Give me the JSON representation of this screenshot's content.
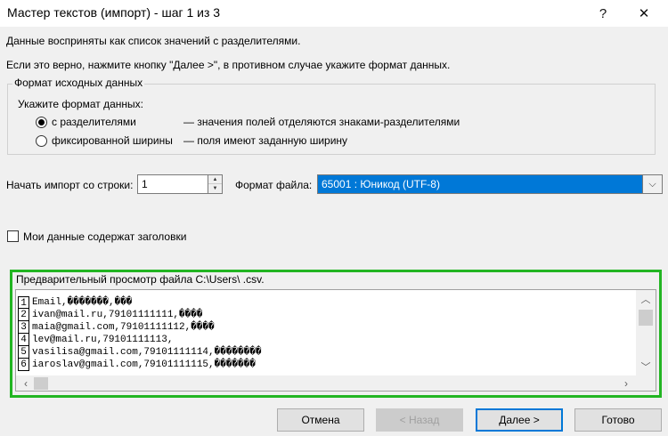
{
  "window": {
    "title": "Мастер текстов (импорт) - шаг 1 из 3",
    "help_glyph": "?",
    "close_glyph": "✕"
  },
  "intro": {
    "line1": "Данные восприняты как список значений с разделителями.",
    "line2": "Если это верно, нажмите кнопку \"Далее >\", в противном случае укажите формат данных."
  },
  "source_format": {
    "legend": "Формат исходных данных",
    "prompt": "Укажите формат данных:",
    "options": [
      {
        "label": "с разделителями",
        "description": "— значения полей отделяются знаками-разделителями",
        "checked": true
      },
      {
        "label": "фиксированной ширины",
        "description": "— поля имеют заданную ширину",
        "checked": false
      }
    ]
  },
  "import": {
    "start_row_label": "Начать импорт со строки:",
    "start_row_value": "1",
    "file_format_label": "Формат файла:",
    "file_format_value": "65001 : Юникод (UTF-8)"
  },
  "headers_checkbox": {
    "label": "Мои данные содержат заголовки",
    "checked": false
  },
  "preview": {
    "label": "Предварительный просмотр файла C:\\Users\\                              .csv.",
    "rows": [
      {
        "num": "1",
        "text": "Email,�������,���"
      },
      {
        "num": "2",
        "text": "ivan@mail.ru,79101111111,����"
      },
      {
        "num": "3",
        "text": "maia@gmail.com,79101111112,����"
      },
      {
        "num": "4",
        "text": "lev@mail.ru,79101111113,"
      },
      {
        "num": "5",
        "text": "vasilisa@gmail.com,79101111114,��������"
      },
      {
        "num": "6",
        "text": "iaroslav@gmail.com,79101111115,�������"
      }
    ]
  },
  "buttons": {
    "cancel": "Отмена",
    "back": "< Назад",
    "next": "Далее >",
    "finish": "Готово"
  },
  "colors": {
    "highlight_frame": "#22b522",
    "selection": "#0078d7"
  }
}
